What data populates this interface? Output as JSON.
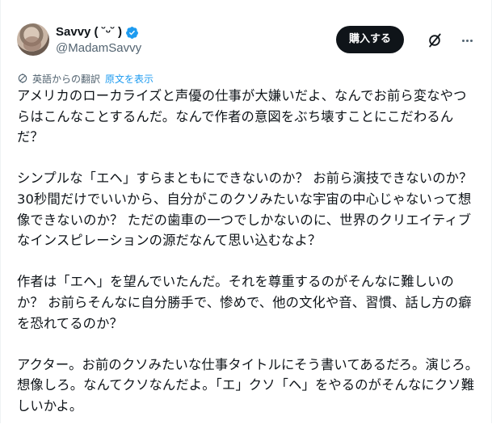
{
  "user": {
    "display_name": "Savvy ( ˘ᵕ˘ )",
    "handle": "@MadamSavvy",
    "verified": true
  },
  "actions": {
    "buy_label": "購入する",
    "grok_icon": "grok-slash-circle-icon",
    "more_icon": "more-horizontal-icon"
  },
  "translation": {
    "note": "英語からの翻訳",
    "show_original": "原文を表示"
  },
  "tweet": {
    "paragraphs": [
      "アメリカのローカライズと声優の仕事が大嫌いだよ、なんでお前ら変なやつらはこんなことするんだ。なんで作者の意図をぶち壊すことにこだわるんだ？",
      "シンプルな「エヘ」すらまともにできないのか？ お前ら演技できないのか？ 30秒間だけでいいから、自分がこのクソみたいな宇宙の中心じゃないって想像できないのか？ ただの歯車の一つでしかないのに、世界のクリエイティブなインスピレーションの源だなんて思い込むなよ？",
      "作者は「エヘ」を望んでいたんだ。それを尊重するのがそんなに難しいのか？ お前らそんなに自分勝手で、惨めで、他の文化や音、習慣、話し方の癖を恐れてるのか？",
      "アクター。お前のクソみたいな仕事タイトルにそう書いてあるだろ。演じろ。想像しろ。なんてクソなんだよ。「エ」クソ「ヘ」をやるのがそんなにクソ難しいかよ。"
    ]
  },
  "colors": {
    "text": "#0f1419",
    "secondary": "#536471",
    "link": "#1d9bf0",
    "button_bg": "#0f1419"
  }
}
